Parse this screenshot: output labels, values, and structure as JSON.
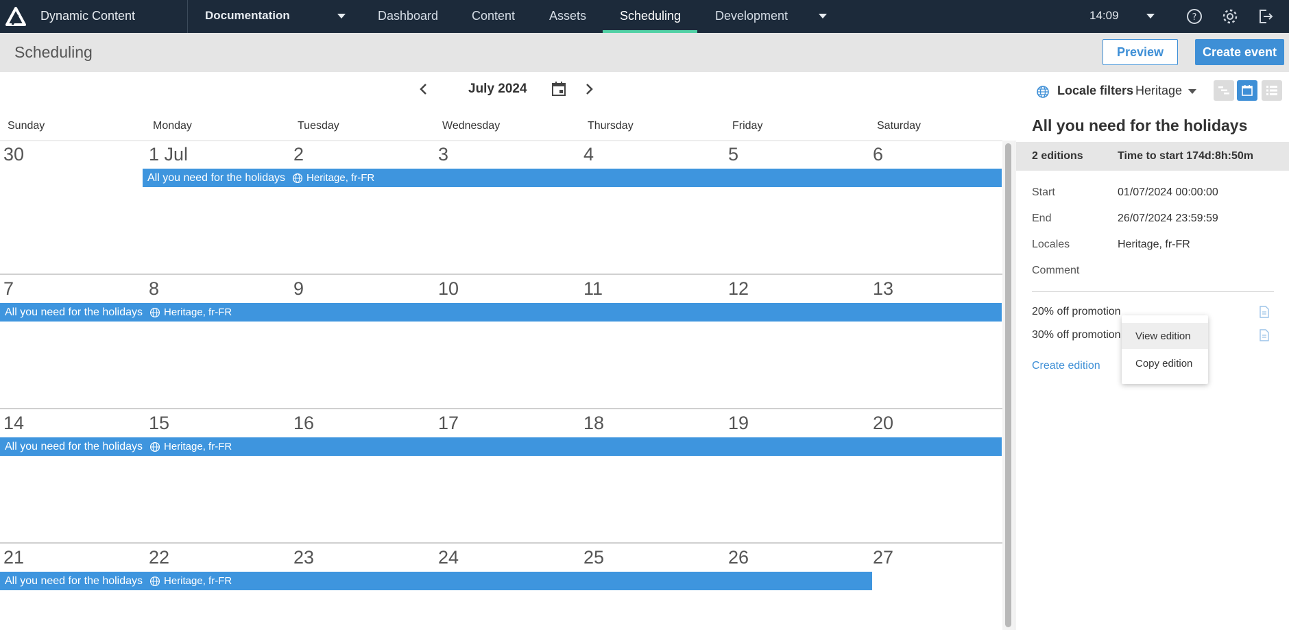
{
  "nav": {
    "app_name": "Dynamic Content",
    "hub": "Documentation",
    "links": [
      "Dashboard",
      "Content",
      "Assets",
      "Scheduling",
      "Development"
    ],
    "active": "Scheduling",
    "clock": "14:09"
  },
  "subheader": {
    "title": "Scheduling",
    "preview_label": "Preview",
    "create_event_label": "Create event"
  },
  "toolbar": {
    "month": "July 2024",
    "locale_filters_label": "Locale filters",
    "locale_value": "Heritage"
  },
  "calendar": {
    "weekdays": [
      "Sunday",
      "Monday",
      "Tuesday",
      "Wednesday",
      "Thursday",
      "Friday",
      "Saturday"
    ],
    "weeks": [
      [
        "30",
        "1 Jul",
        "2",
        "3",
        "4",
        "5",
        "6"
      ],
      [
        "7",
        "8",
        "9",
        "10",
        "11",
        "12",
        "13"
      ],
      [
        "14",
        "15",
        "16",
        "17",
        "18",
        "19",
        "20"
      ],
      [
        "21",
        "22",
        "23",
        "24",
        "25",
        "26",
        "27"
      ]
    ],
    "event": {
      "name": "All you need for the holidays",
      "locales": "Heritage, fr-FR"
    }
  },
  "panel": {
    "title": "All you need for the holidays",
    "editions_count": "2 editions",
    "time_to_start": "Time to start 174d:8h:50m",
    "details": [
      {
        "label": "Start",
        "value": "01/07/2024 00:00:00"
      },
      {
        "label": "End",
        "value": "26/07/2024 23:59:59"
      },
      {
        "label": "Locales",
        "value": "Heritage, fr-FR"
      },
      {
        "label": "Comment",
        "value": ""
      }
    ],
    "editions": [
      "20% off promotion",
      "30% off promotion"
    ],
    "create_edition_label": "Create edition"
  },
  "context_menu": {
    "items": [
      "View edition",
      "Copy edition"
    ]
  },
  "colors": {
    "nav_bg": "#1c2a3a",
    "accent": "#3e8fd6",
    "event_bar": "#3e95de",
    "active_tab": "#52d1a5"
  }
}
